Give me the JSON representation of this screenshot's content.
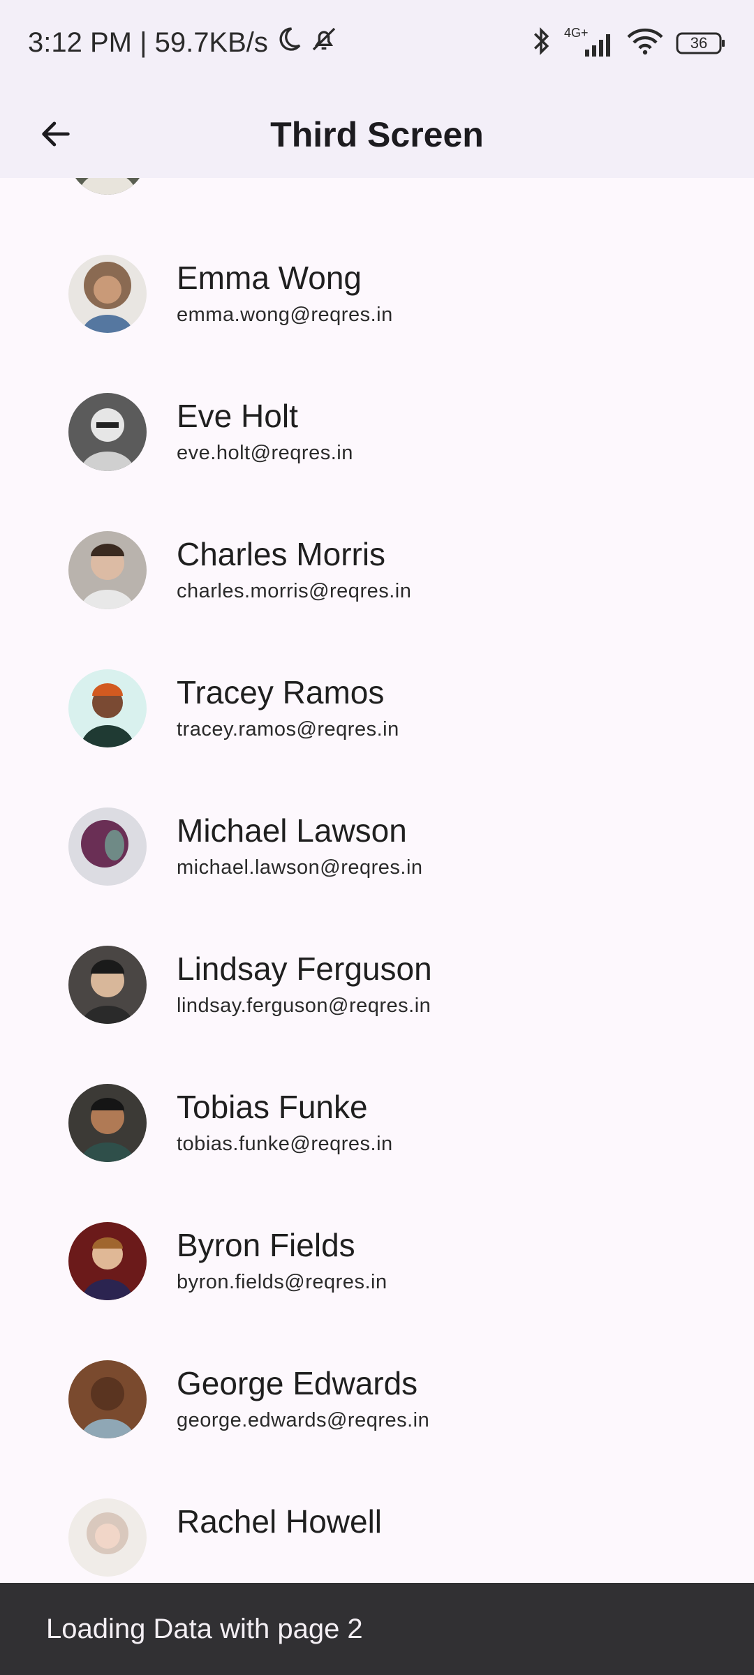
{
  "status_bar": {
    "time_speed": "3:12 PM | 59.7KB/s",
    "network_label": "4G+",
    "battery": "36"
  },
  "app_bar": {
    "title": "Third Screen",
    "back_icon": "arrow-back-icon"
  },
  "users": [
    {
      "name": "",
      "email": "",
      "avatar_color": "#5a5f52"
    },
    {
      "name": "Emma Wong",
      "email": "emma.wong@reqres.in",
      "avatar_color": "#8a6a52"
    },
    {
      "name": "Eve Holt",
      "email": "eve.holt@reqres.in",
      "avatar_color": "#5b5b5b"
    },
    {
      "name": "Charles Morris",
      "email": "charles.morris@reqres.in",
      "avatar_color": "#b9b3ad"
    },
    {
      "name": "Tracey Ramos",
      "email": "tracey.ramos@reqres.in",
      "avatar_color": "#1f3a33"
    },
    {
      "name": "Michael Lawson",
      "email": "michael.lawson@reqres.in",
      "avatar_color": "#6a2f55"
    },
    {
      "name": "Lindsay Ferguson",
      "email": "lindsay.ferguson@reqres.in",
      "avatar_color": "#4a4644"
    },
    {
      "name": "Tobias Funke",
      "email": "tobias.funke@reqres.in",
      "avatar_color": "#3c3a36"
    },
    {
      "name": "Byron Fields",
      "email": "byron.fields@reqres.in",
      "avatar_color": "#6b1a1a"
    },
    {
      "name": "George Edwards",
      "email": "george.edwards@reqres.in",
      "avatar_color": "#7a4a2e"
    },
    {
      "name": "Rachel Howell",
      "email": "",
      "avatar_color": "#d9c8bd"
    }
  ],
  "snackbar": {
    "message": "Loading Data with page 2"
  }
}
